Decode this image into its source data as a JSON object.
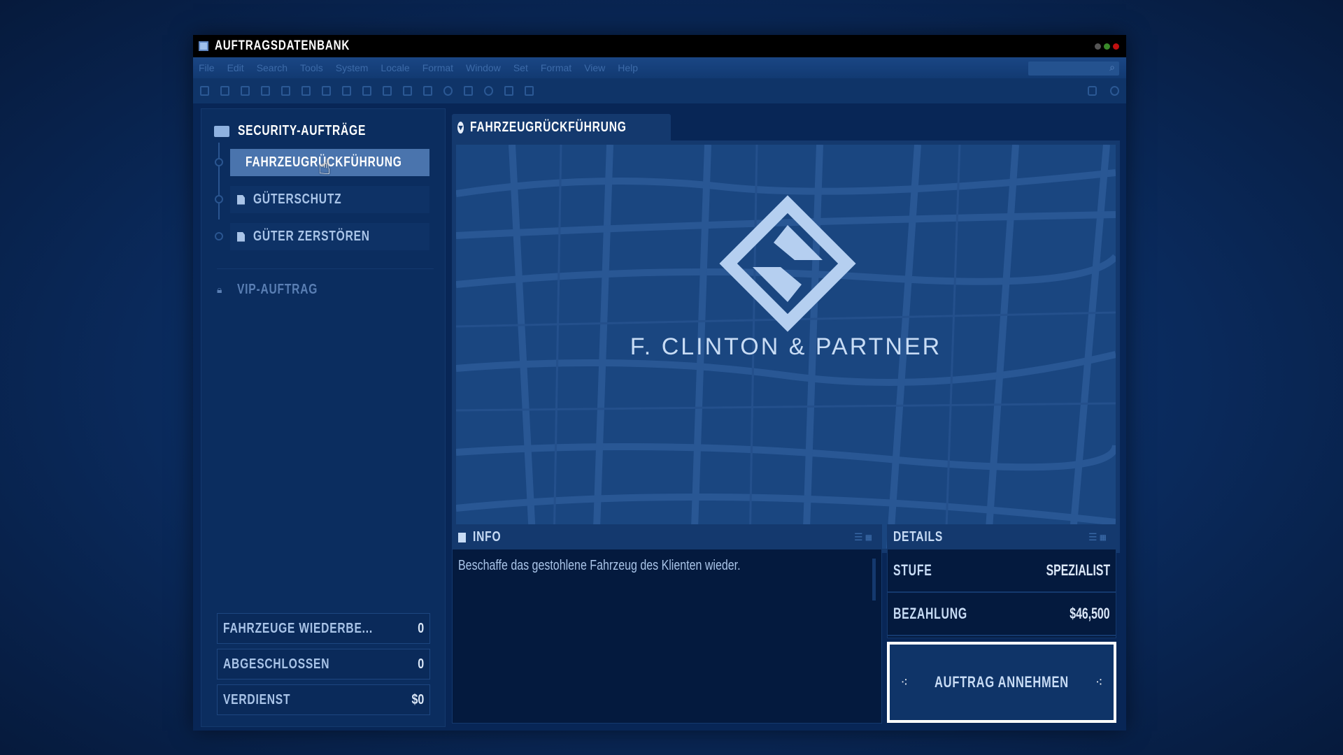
{
  "window": {
    "title": "AUFTRAGSDATENBANK"
  },
  "menu": [
    "File",
    "Edit",
    "Search",
    "Tools",
    "System",
    "Locale",
    "Format",
    "Window",
    "Set",
    "Format",
    "View",
    "Help"
  ],
  "sidebar": {
    "group_label": "SECURITY-AUFTRÄGE",
    "items": [
      {
        "label": "FAHRZEUGRÜCKFÜHRUNG",
        "selected": true
      },
      {
        "label": "GÜTERSCHUTZ"
      },
      {
        "label": "GÜTER ZERSTÖREN"
      }
    ],
    "locked_group": "VIP-AUFTRAG",
    "stats": [
      {
        "label": "FAHRZEUGE WIEDERBE...",
        "value": "0"
      },
      {
        "label": "ABGESCHLOSSEN",
        "value": "0"
      },
      {
        "label": "VERDIENST",
        "value": "$0"
      }
    ]
  },
  "main": {
    "tab_label": "FAHRZEUGRÜCKFÜHRUNG",
    "brand": "F. CLINTON & PARTNER",
    "info": {
      "title": "INFO",
      "text": "Beschaffe das gestohlene Fahrzeug des Klienten wieder."
    },
    "details": {
      "title": "DETAILS",
      "rows": [
        {
          "label": "STUFE",
          "value": "SPEZIALIST"
        },
        {
          "label": "BEZAHLUNG",
          "value": "$46,500"
        }
      ]
    },
    "accept_label": "AUFTRAG ANNEHMEN"
  },
  "colors": {
    "accent": "#4a74ad",
    "bg": "#082656"
  }
}
